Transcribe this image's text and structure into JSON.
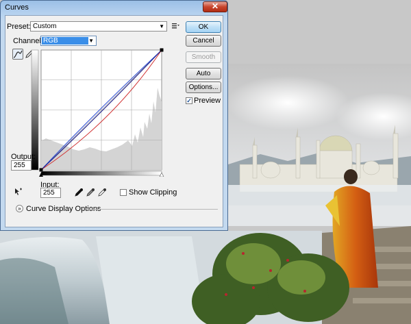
{
  "window": {
    "title": "Curves",
    "close_glyph": "✕"
  },
  "preset": {
    "label": "Preset:",
    "value": "Custom",
    "menu_icon": "preset-menu-icon"
  },
  "channel": {
    "label": "Channel:",
    "value": "RGB"
  },
  "buttons": {
    "ok": "OK",
    "cancel": "Cancel",
    "smooth": "Smooth",
    "auto": "Auto",
    "options": "Options..."
  },
  "preview": {
    "label": "Preview",
    "checked": true
  },
  "output": {
    "label": "Output:",
    "value": "255"
  },
  "input": {
    "label": "Input:",
    "value": "255"
  },
  "show_clipping": {
    "label": "Show Clipping",
    "checked": false
  },
  "curve_display_options": {
    "label": "Curve Display Options"
  },
  "colors": {
    "rgb_curve": "#22228a",
    "blue_curve": "#2f4fd8",
    "red_curve": "#d03030",
    "channel_highlight": "#3a8ee8",
    "histogram_fill": "#d4d4d4"
  }
}
